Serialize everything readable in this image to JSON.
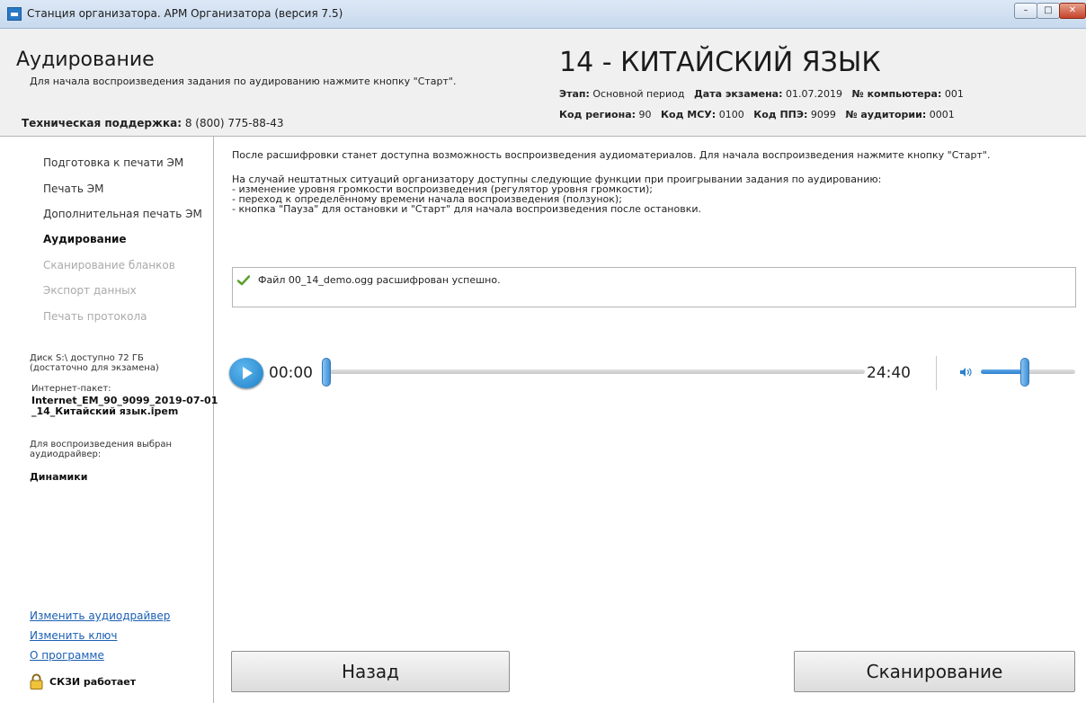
{
  "window": {
    "title": "Станция организатора. АРМ Организатора (версия 7.5)",
    "controls": {
      "minimize": "–",
      "maximize": "□",
      "close": "✕"
    }
  },
  "header": {
    "section_title": "Аудирование",
    "hint": "Для начала воспроизведения задания по аудированию нажмите кнопку \"Старт\".",
    "support_label": "Техническая поддержка:",
    "support_phone": "8 (800) 775-88-43",
    "subject": "14 - КИТАЙСКИЙ ЯЗЫК",
    "stage_label": "Этап:",
    "stage_value": "Основной период",
    "exam_date_label": "Дата экзамена:",
    "exam_date_value": "01.07.2019",
    "computer_label": "№ компьютера:",
    "computer_value": "001",
    "region_label": "Код региона:",
    "region_value": "90",
    "msu_label": "Код МСУ:",
    "msu_value": "0100",
    "ppe_label": "Код ППЭ:",
    "ppe_value": "9099",
    "auditorium_label": "№ аудитории:",
    "auditorium_value": "0001"
  },
  "sidebar": {
    "nav": [
      {
        "label": "Подготовка к печати ЭМ",
        "state": "normal"
      },
      {
        "label": "Печать ЭМ",
        "state": "normal"
      },
      {
        "label": "Дополнительная печать ЭМ",
        "state": "normal"
      },
      {
        "label": "Аудирование",
        "state": "active"
      },
      {
        "label": "Сканирование бланков",
        "state": "disabled"
      },
      {
        "label": "Экспорт данных",
        "state": "disabled"
      },
      {
        "label": "Печать протокола",
        "state": "disabled"
      }
    ],
    "disk_line1": "Диск S:\\ доступно 72 ГБ",
    "disk_line2": "(достаточно для экзамена)",
    "package_label": "Интернет-пакет:",
    "package_name_line1": "Internet_EM_90_9099_2019-07-01",
    "package_name_line2": "_14_Китайский язык.ipem",
    "driver_label_line1": "Для воспроизведения выбран",
    "driver_label_line2": "аудиодрайвер:",
    "driver_value": "Динамики",
    "links": {
      "change_driver": "Изменить аудиодрайвер",
      "change_key": "Изменить ключ",
      "about": "О программе"
    },
    "skzi_status": "СКЗИ работает"
  },
  "main": {
    "intro": "После расшифровки станет доступна возможность воспроизведения аудиоматериалов. Для начала воспроизведения нажмите кнопку \"Старт\".",
    "functions_title": "На случай нештатных ситуаций организатору доступны следующие функции при проигрывании задания по аудированию:",
    "functions": [
      " - изменение уровня громкости воспроизведения (регулятор уровня громкости);",
      " - переход к определённому времени начала воспроизведения (ползунок);",
      " - кнопка \"Пауза\" для остановки и \"Старт\" для начала воспроизведения после остановки."
    ],
    "status_message": "Файл 00_14_demo.ogg расшифрован успешно."
  },
  "player": {
    "current_time": "00:00",
    "total_time": "24:40",
    "progress": 0,
    "volume": 0.47
  },
  "buttons": {
    "back": "Назад",
    "scan": "Сканирование"
  },
  "colors": {
    "accent": "#2e80cd",
    "link": "#1a5fb4",
    "success": "#5aa02c"
  }
}
